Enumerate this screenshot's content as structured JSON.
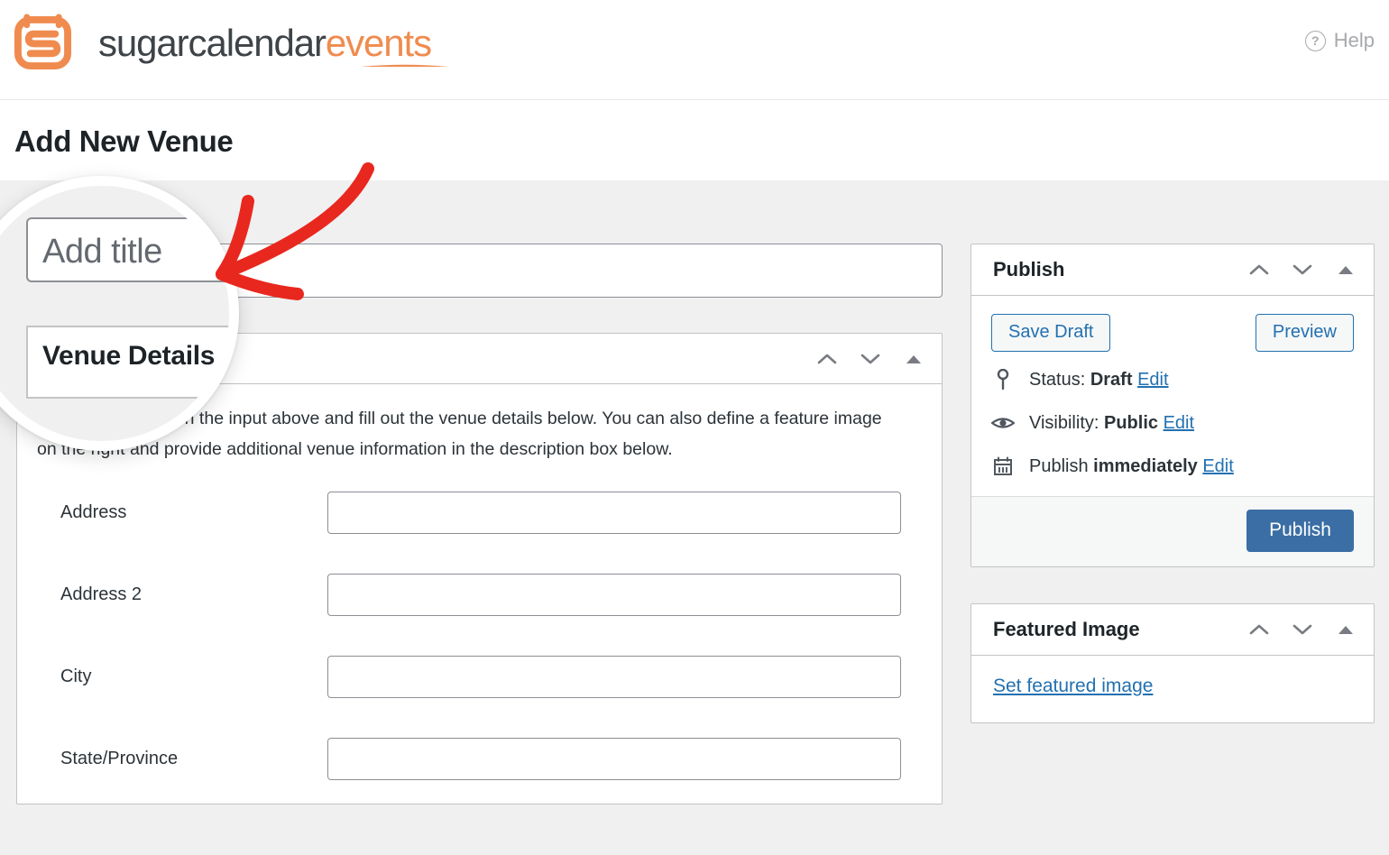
{
  "brand": {
    "icon": "sugar-calendar-logo-icon",
    "name_primary": "sugarcalendar",
    "name_accent": "events",
    "accent_color": "#f08b4f",
    "dark_color": "#3e4348"
  },
  "header": {
    "help_label": "Help",
    "help_icon": "question-circle-icon"
  },
  "page": {
    "title": "Add New Venue"
  },
  "editor": {
    "title_placeholder": "Add title"
  },
  "venue_details": {
    "panel_title": "Venue Details",
    "description": "Name your venue in the input above and fill out the venue details below. You can also define a feature image on the right and provide additional venue information in the description box below.",
    "fields": [
      {
        "label": "Address",
        "value": "",
        "placeholder": ""
      },
      {
        "label": "Address 2",
        "value": "",
        "placeholder": ""
      },
      {
        "label": "City",
        "value": "",
        "placeholder": ""
      },
      {
        "label": "State/Province",
        "value": "",
        "placeholder": ""
      }
    ]
  },
  "publish_box": {
    "title": "Publish",
    "save_draft_label": "Save Draft",
    "preview_label": "Preview",
    "status_prefix": "Status:",
    "status_value": "Draft",
    "status_edit": "Edit",
    "status_icon": "pin-icon",
    "visibility_prefix": "Visibility:",
    "visibility_value": "Public",
    "visibility_edit": "Edit",
    "visibility_icon": "eye-icon",
    "schedule_prefix": "Publish",
    "schedule_value": "immediately",
    "schedule_edit": "Edit",
    "schedule_icon": "calendar-icon",
    "publish_label": "Publish",
    "publish_button_color": "#3a6ea5",
    "link_color": "#2271b1"
  },
  "featured_image_box": {
    "title": "Featured Image",
    "set_link": "Set featured image"
  },
  "panel_tools": {
    "move_up_icon": "chevron-up-icon",
    "move_down_icon": "chevron-down-icon",
    "collapse_icon": "triangle-up-icon"
  },
  "annotation": {
    "magnifier": "magnifier-circle-highlight",
    "arrow_icon": "red-curved-arrow",
    "arrow_color": "#e8281e",
    "magnified_title_placeholder": "Add title",
    "magnified_panel_title": "Venue Details"
  }
}
